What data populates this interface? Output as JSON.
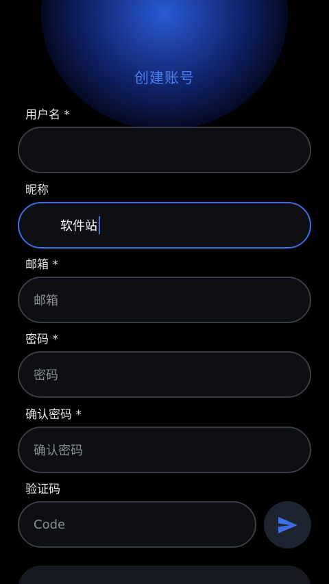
{
  "header": {
    "title": "创建账号"
  },
  "form": {
    "username": {
      "label": "用户名 *",
      "value": "",
      "placeholder": ""
    },
    "nickname": {
      "label": "昵称",
      "value": "软件站"
    },
    "email": {
      "label": "邮箱 *",
      "placeholder": "邮箱"
    },
    "password": {
      "label": "密码 *",
      "placeholder": "密码"
    },
    "confirm_password": {
      "label": "确认密码 *",
      "placeholder": "确认密码"
    },
    "verification": {
      "label": "验证码",
      "placeholder": "Code"
    }
  },
  "icons": {
    "send": "send-icon"
  },
  "colors": {
    "accent": "#3d6fe6",
    "title": "#4d7cf0",
    "field_border": "#3a3d45",
    "background": "#000000"
  }
}
